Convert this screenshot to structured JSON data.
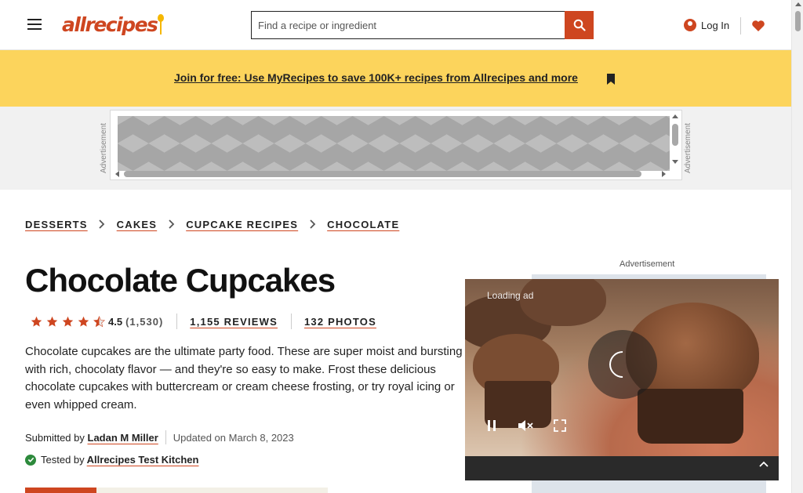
{
  "header": {
    "logo_text": "allrecipes",
    "search": {
      "placeholder": "Find a recipe or ingredient",
      "value": ""
    },
    "login_label": "Log In"
  },
  "banner": {
    "text": "Join for free: Use MyRecipes to save 100K+ recipes from Allrecipes and more"
  },
  "ads": {
    "label": "Advertisement"
  },
  "breadcrumbs": [
    "DESSERTS",
    "CAKES",
    "CUPCAKE RECIPES",
    "CHOCOLATE"
  ],
  "recipe": {
    "title": "Chocolate Cupcakes",
    "rating": {
      "stars": 4.5,
      "value": "4.5",
      "count": "(1,530)"
    },
    "reviews": "1,155 REVIEWS",
    "photos": "132 PHOTOS",
    "description": "Chocolate cupcakes are the ultimate party food. These are super moist and bursting with rich, chocolaty flavor — and they're so easy to make. Frost these delicious chocolate cupcakes with buttercream or cream cheese frosting, or try royal icing or even whipped cream.",
    "submitted_prefix": "Submitted by",
    "author": "Ladan M Miller",
    "updated": "Updated on March 8, 2023",
    "tested_prefix": "Tested by",
    "tester": "Allrecipes Test Kitchen"
  },
  "video": {
    "loading_text": "Loading ad"
  },
  "colors": {
    "brand": "#ce4620",
    "banner": "#fcd45c",
    "tested_badge": "#2d8a3c"
  }
}
